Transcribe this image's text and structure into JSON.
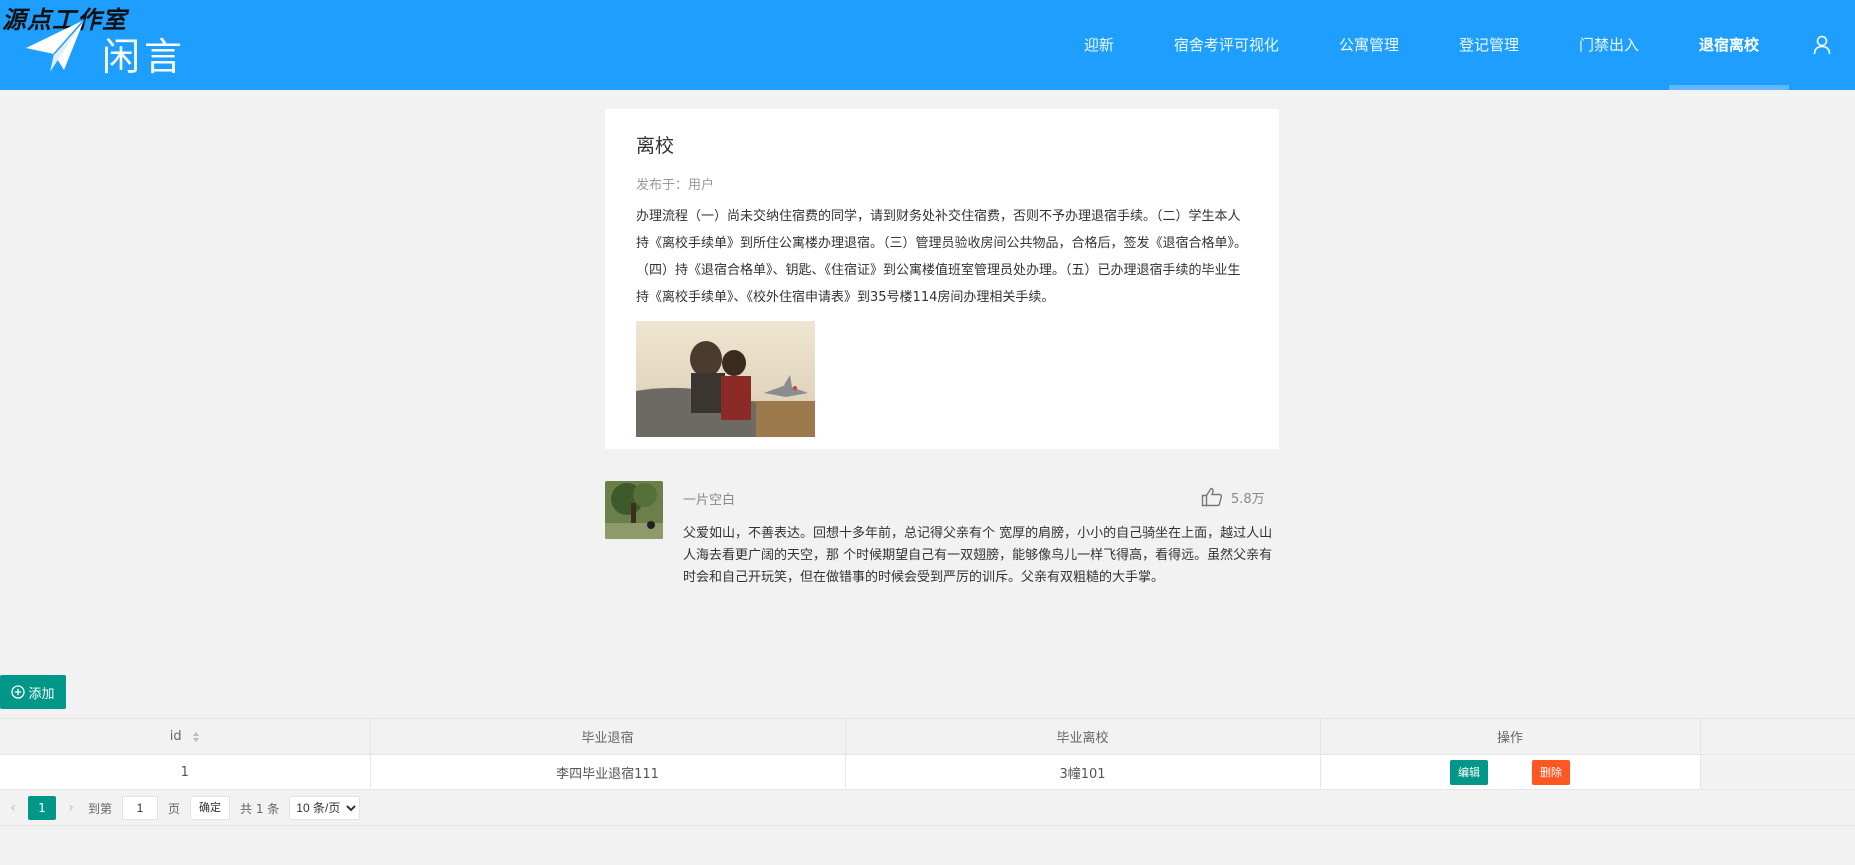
{
  "header": {
    "studio_label": "源点工作室",
    "logo_text": "闲言",
    "nav": [
      "迎新",
      "宿舍考评可视化",
      "公寓管理",
      "登记管理",
      "门禁出入",
      "退宿离校"
    ],
    "active_nav": "退宿离校",
    "bg_color": "#1e9fff"
  },
  "article": {
    "title": "离校",
    "meta": "发布于：用户",
    "body": "办理流程（一）尚未交纳住宿费的同学，请到财务处补交住宿费，否则不予办理退宿手续。（二）学生本人持《离校手续单》到所住公寓楼办理退宿。（三）管理员验收房间公共物品，合格后，签发《退宿合格单》。（四）持《退宿合格单》、钥匙、《住宿证》到公寓楼值班室管理员处办理。（五）已办理退宿手续的毕业生持《离校手续单》、《校外住宿申请表》到35号楼114房间办理相关手续。"
  },
  "comment": {
    "name": "一片空白",
    "likes": "5.8万",
    "text": "父爱如山，不善表达。回想十多年前，总记得父亲有个 宽厚的肩膀，小小的自己骑坐在上面，越过人山人海去看更广阔的天空，那 个时候期望自己有一双翅膀，能够像鸟儿一样飞得高，看得远。虽然父亲有 时会和自己开玩笑，但在做错事的时候会受到严厉的训斥。父亲有双粗糙的大手掌。"
  },
  "toolbar": {
    "add_label": "添加"
  },
  "table": {
    "headers": {
      "id": "id",
      "col1": "毕业退宿",
      "col2": "毕业离校",
      "ops": "操作"
    },
    "rows": [
      {
        "id": "1",
        "col1": "李四毕业退宿111",
        "col2": "3幢101"
      }
    ],
    "edit_label": "编辑",
    "delete_label": "删除"
  },
  "pager": {
    "current_page": "1",
    "goto_label": "到第",
    "goto_value": "1",
    "page_unit": "页",
    "confirm_label": "确定",
    "total_label": "共 1 条",
    "page_size_options": [
      "10 条/页"
    ]
  },
  "colors": {
    "primary": "#1e9fff",
    "teal": "#009688",
    "danger": "#ff5722"
  },
  "icons": [
    "paper-plane-icon",
    "user-icon",
    "thumbs-up-icon",
    "plus-circle-icon",
    "sort-icon",
    "chevron-left-icon",
    "chevron-right-icon"
  ]
}
